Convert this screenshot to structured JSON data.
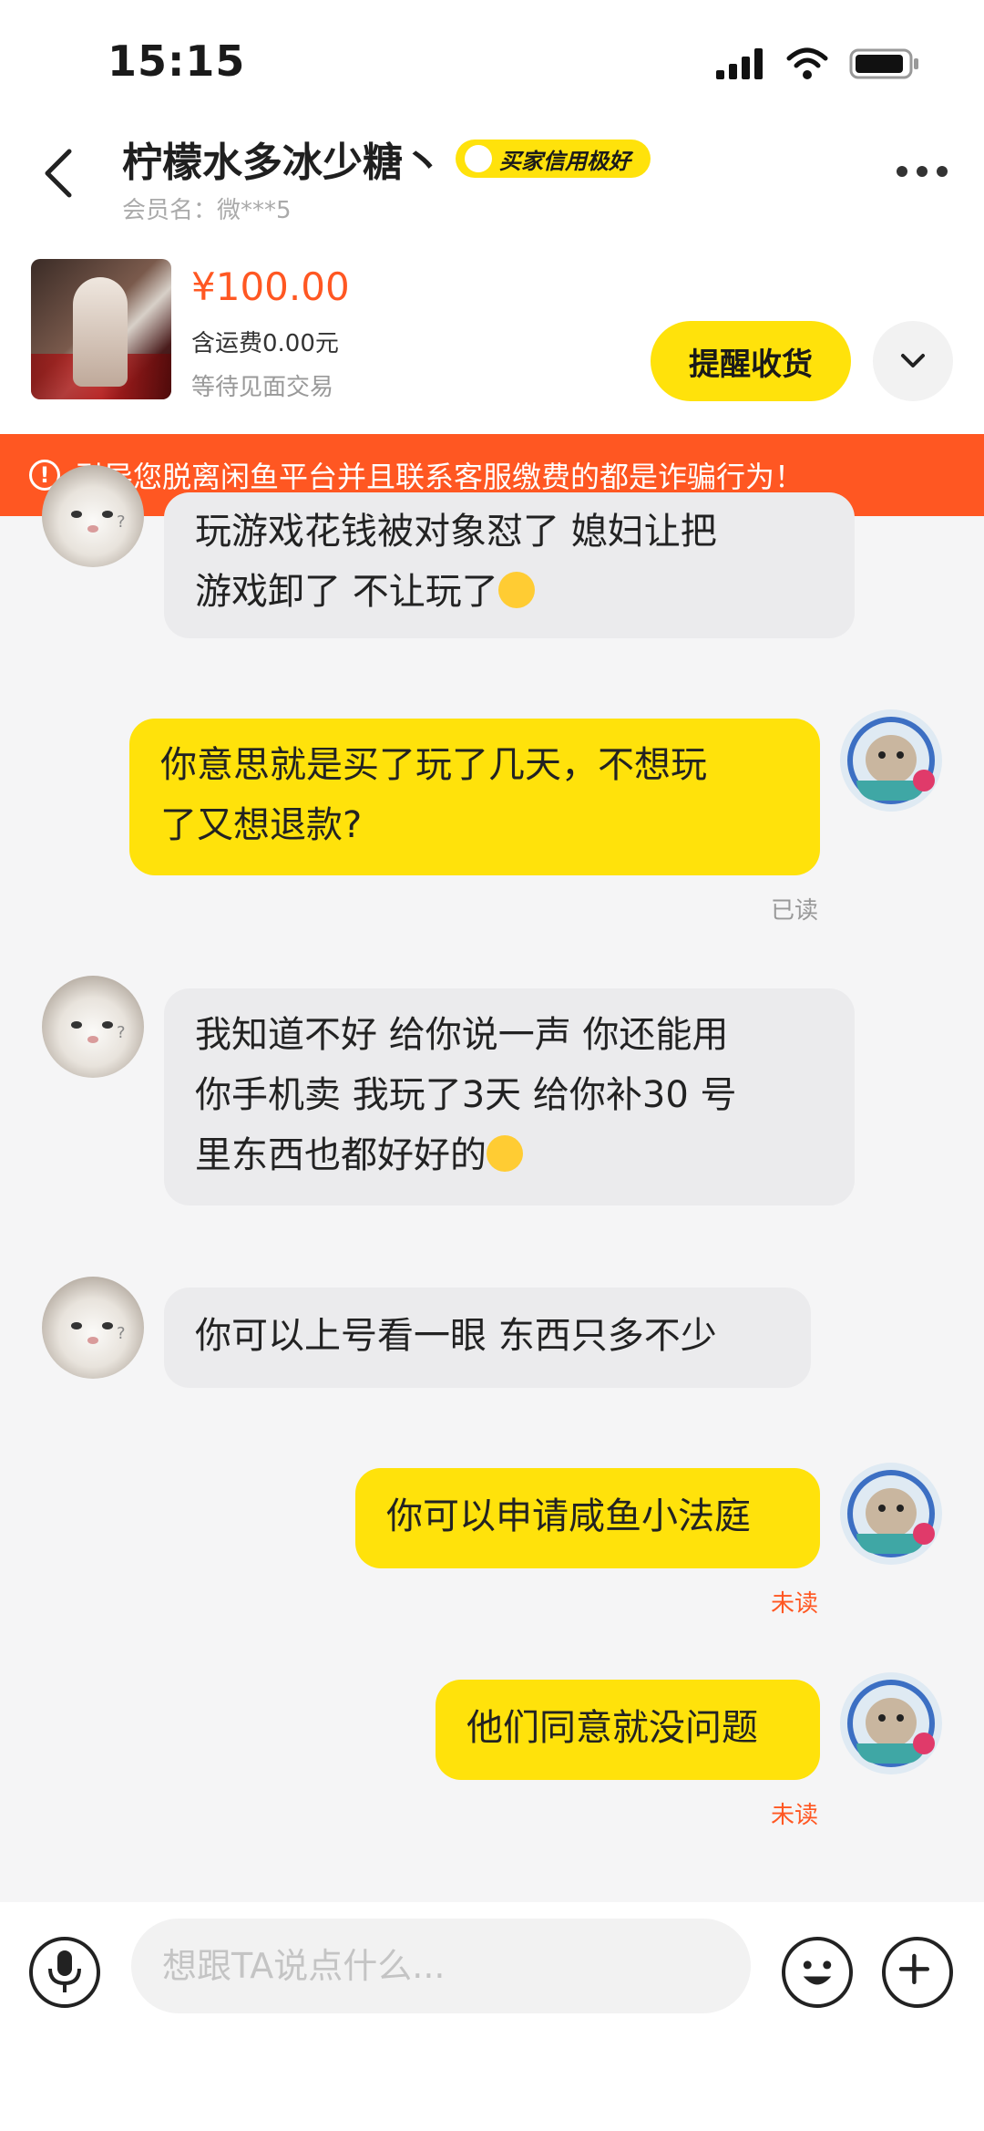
{
  "status_bar": {
    "time": "15:15"
  },
  "header": {
    "title": "柠檬水多冰少糖丶",
    "credit_badge": "买家信用极好",
    "member_name": "会员名：微***5",
    "icons": {
      "back": "back-chevron-icon",
      "more": "more-dots-icon"
    }
  },
  "order": {
    "price": "¥100.00",
    "shipping": "含运费0.00元",
    "status": "等待见面交易",
    "remind_button": "提醒收货",
    "expand_icon": "chevron-down-icon"
  },
  "warning": {
    "text": "引导您脱离闲鱼平台并且联系客服缴费的都是诈骗行为！",
    "icon": "exclamation-circle-icon",
    "color": "#ff5722"
  },
  "messages": [
    {
      "side": "left",
      "line1": "玩游戏花钱被对象怼了  媳妇让把",
      "line2": "游戏卸了  不让玩了",
      "emoji": "crying-emoji"
    },
    {
      "side": "right",
      "line1": "你意思就是买了玩了几天，不想玩",
      "line2": "了又想退款?",
      "status": "已读"
    },
    {
      "side": "left",
      "line1": "我知道不好  给你说一声  你还能用",
      "line2": "你手机卖  我玩了3天  给你补30  号",
      "line3": "里东西也都好好的",
      "emoji": "crying-emoji"
    },
    {
      "side": "left",
      "line1": "你可以上号看一眼  东西只多不少"
    },
    {
      "side": "right",
      "line1": "你可以申请咸鱼小法庭",
      "status": "未读"
    },
    {
      "side": "right",
      "line1": "他们同意就没问题",
      "status": "未读"
    }
  ],
  "input_bar": {
    "placeholder": "想跟TA说点什么...",
    "icons": {
      "voice": "microphone-icon",
      "emoji": "emoji-face-icon",
      "plus": "plus-circle-icon"
    }
  },
  "colors": {
    "accent_yellow": "#ffe20b",
    "alert_orange": "#ff5722",
    "left_bubble": "#ebebed"
  }
}
